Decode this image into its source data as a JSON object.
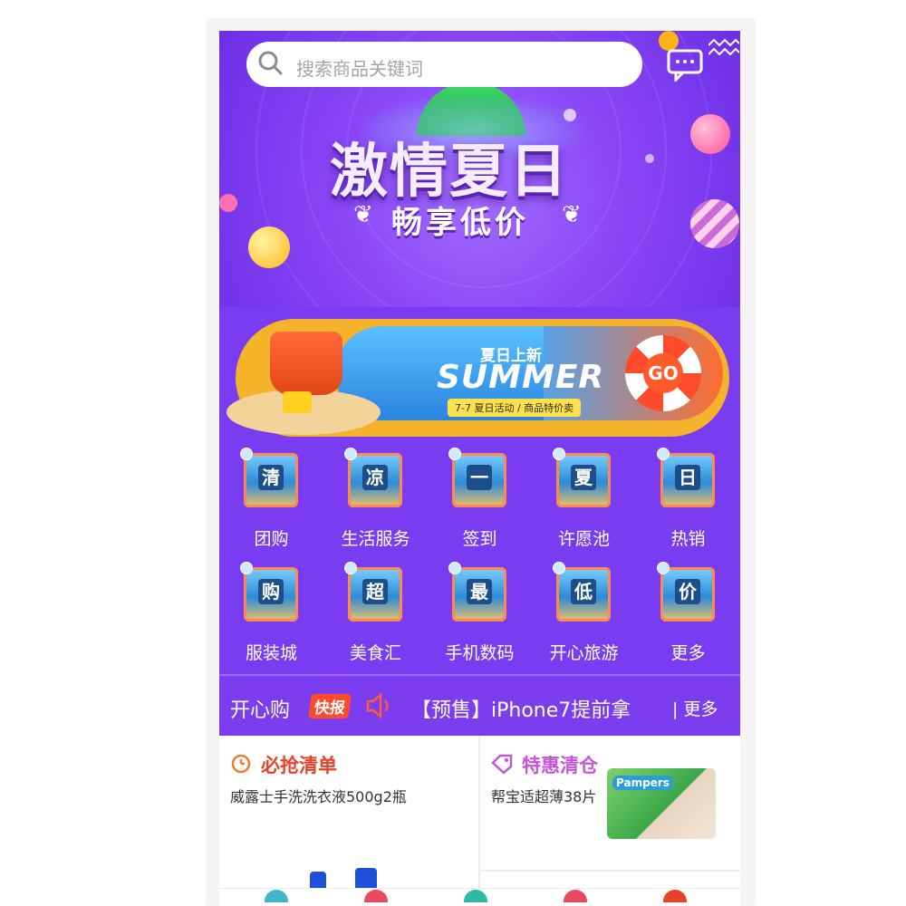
{
  "search": {
    "placeholder": "搜索商品关键词"
  },
  "hero": {
    "title": "激情夏日",
    "subtitle": "畅享低价"
  },
  "banner": {
    "cn_title": "夏日上新",
    "en_title": "SUMMER",
    "subtitle": "7-7 夏日活动 / 商品特价卖",
    "go_label": "GO"
  },
  "categories": [
    {
      "badge": "清",
      "label": "团购"
    },
    {
      "badge": "凉",
      "label": "生活服务"
    },
    {
      "badge": "一",
      "label": "签到"
    },
    {
      "badge": "夏",
      "label": "许愿池"
    },
    {
      "badge": "日",
      "label": "热销"
    },
    {
      "badge": "购",
      "label": "服装城"
    },
    {
      "badge": "超",
      "label": "美食汇"
    },
    {
      "badge": "最",
      "label": "手机数码"
    },
    {
      "badge": "低",
      "label": "开心旅游"
    },
    {
      "badge": "价",
      "label": "更多"
    }
  ],
  "ticker": {
    "brand": "开心购",
    "flash_badge": "快报",
    "headline": "【预售】iPhone7提前拿",
    "more": "| 更多"
  },
  "sections": {
    "must_buy": {
      "title": "必抢清单",
      "item": "威露士手洗洗衣液500g2瓶"
    },
    "clearance": {
      "title": "特惠清仓",
      "item": "帮宝适超薄38片",
      "brand": "Pampers"
    }
  },
  "colors": {
    "hero_purple": "#7a3cf0",
    "accent_orange": "#ff4a2c",
    "must_buy": "#e8412a",
    "clearance": "#c356d8"
  }
}
